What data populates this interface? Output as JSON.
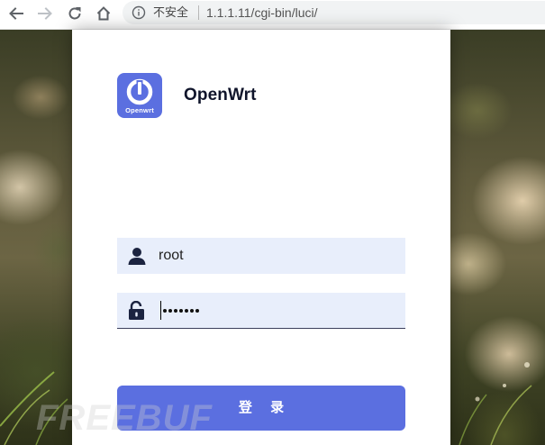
{
  "browser": {
    "security_label": "不安全",
    "url": "1.1.1.11/cgi-bin/luci/"
  },
  "login": {
    "logo_label": "Openwrt",
    "brand_title": "OpenWrt",
    "username_value": "root",
    "password_masked_count": 7,
    "submit_label": "登 录"
  },
  "watermark": "FREEBUF",
  "icons": [
    "back-arrow-icon",
    "forward-arrow-icon",
    "reload-icon",
    "home-icon",
    "info-icon",
    "user-icon",
    "unlock-icon"
  ],
  "colors": {
    "accent": "#5b6fe0",
    "field_bg": "#e8eefb",
    "brand_text": "#10152b"
  }
}
